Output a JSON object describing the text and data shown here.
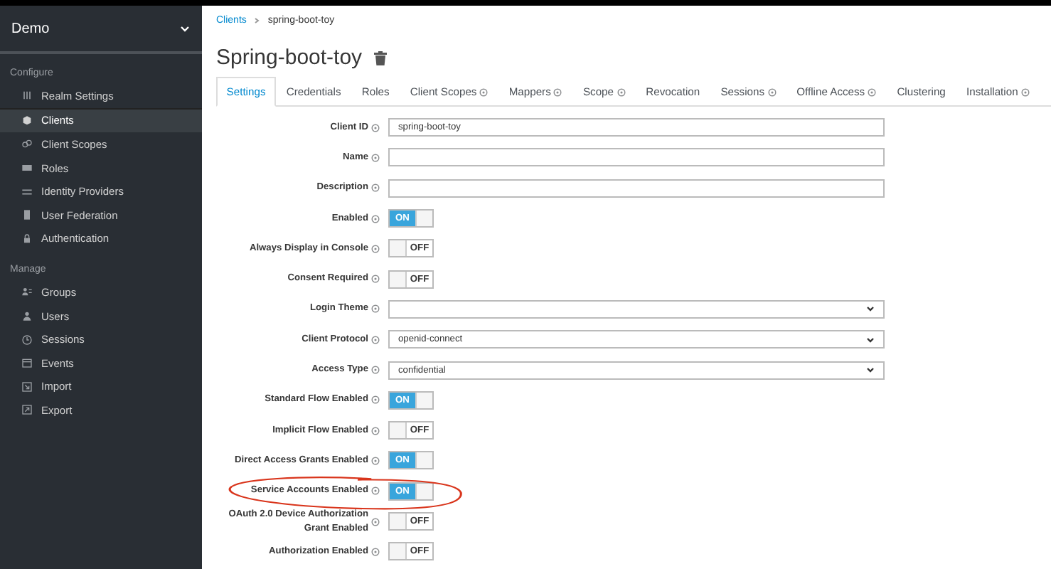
{
  "sidebar": {
    "realm": "Demo",
    "sections": [
      {
        "heading": "Configure",
        "items": [
          {
            "label": "Realm Settings",
            "selected": false
          },
          {
            "label": "Clients",
            "selected": true
          },
          {
            "label": "Client Scopes",
            "selected": false
          },
          {
            "label": "Roles",
            "selected": false
          },
          {
            "label": "Identity Providers",
            "selected": false
          },
          {
            "label": "User Federation",
            "selected": false
          },
          {
            "label": "Authentication",
            "selected": false
          }
        ]
      },
      {
        "heading": "Manage",
        "items": [
          {
            "label": "Groups",
            "selected": false
          },
          {
            "label": "Users",
            "selected": false
          },
          {
            "label": "Sessions",
            "selected": false
          },
          {
            "label": "Events",
            "selected": false
          },
          {
            "label": "Import",
            "selected": false
          },
          {
            "label": "Export",
            "selected": false
          }
        ]
      }
    ]
  },
  "breadcrumb": [
    "Clients",
    "spring-boot-toy"
  ],
  "title": "Spring-boot-toy",
  "tabs": [
    {
      "label": "Settings",
      "help": false,
      "selected": true
    },
    {
      "label": "Credentials",
      "help": false,
      "selected": false
    },
    {
      "label": "Roles",
      "help": false,
      "selected": false
    },
    {
      "label": "Client Scopes",
      "help": true,
      "selected": false
    },
    {
      "label": "Mappers",
      "help": true,
      "selected": false
    },
    {
      "label": "Scope",
      "help": true,
      "selected": false
    },
    {
      "label": "Revocation",
      "help": false,
      "selected": false
    },
    {
      "label": "Sessions",
      "help": true,
      "selected": false
    },
    {
      "label": "Offline Access",
      "help": true,
      "selected": false
    },
    {
      "label": "Clustering",
      "help": false,
      "selected": false
    },
    {
      "label": "Installation",
      "help": true,
      "selected": false
    }
  ],
  "fields": [
    {
      "kind": "text",
      "label": "Client ID",
      "value": "spring-boot-toy",
      "circled": false
    },
    {
      "kind": "text",
      "label": "Name",
      "circled": false
    },
    {
      "kind": "text",
      "label": "Description",
      "circled": false
    },
    {
      "kind": "switch",
      "label": "Enabled",
      "on": true,
      "text": "ON",
      "circled": false
    },
    {
      "kind": "switch",
      "label": "Always Display in Console",
      "on": false,
      "text": "OFF",
      "circled": false
    },
    {
      "kind": "switch",
      "label": "Consent Required",
      "on": false,
      "text": "OFF",
      "circled": false
    },
    {
      "kind": "select",
      "label": "Login Theme",
      "circled": false
    },
    {
      "kind": "select",
      "label": "Client Protocol",
      "value": "openid-connect",
      "circled": false
    },
    {
      "kind": "select",
      "label": "Access Type",
      "value": "confidential",
      "circled": false
    },
    {
      "kind": "switch",
      "label": "Standard Flow Enabled",
      "on": true,
      "text": "ON",
      "circled": false
    },
    {
      "kind": "switch",
      "label": "Implicit Flow Enabled",
      "on": false,
      "text": "OFF",
      "circled": false
    },
    {
      "kind": "switch",
      "label": "Direct Access Grants Enabled",
      "on": true,
      "text": "ON",
      "circled": false
    },
    {
      "kind": "switch",
      "label": "Service Accounts Enabled",
      "on": true,
      "text": "ON",
      "circled": true
    },
    {
      "kind": "switch",
      "label": "OAuth 2.0 Device Authorization Grant Enabled",
      "on": false,
      "text": "OFF",
      "circled": false
    },
    {
      "kind": "switch",
      "label": "Authorization Enabled",
      "on": false,
      "text": "OFF",
      "circled": false
    }
  ]
}
